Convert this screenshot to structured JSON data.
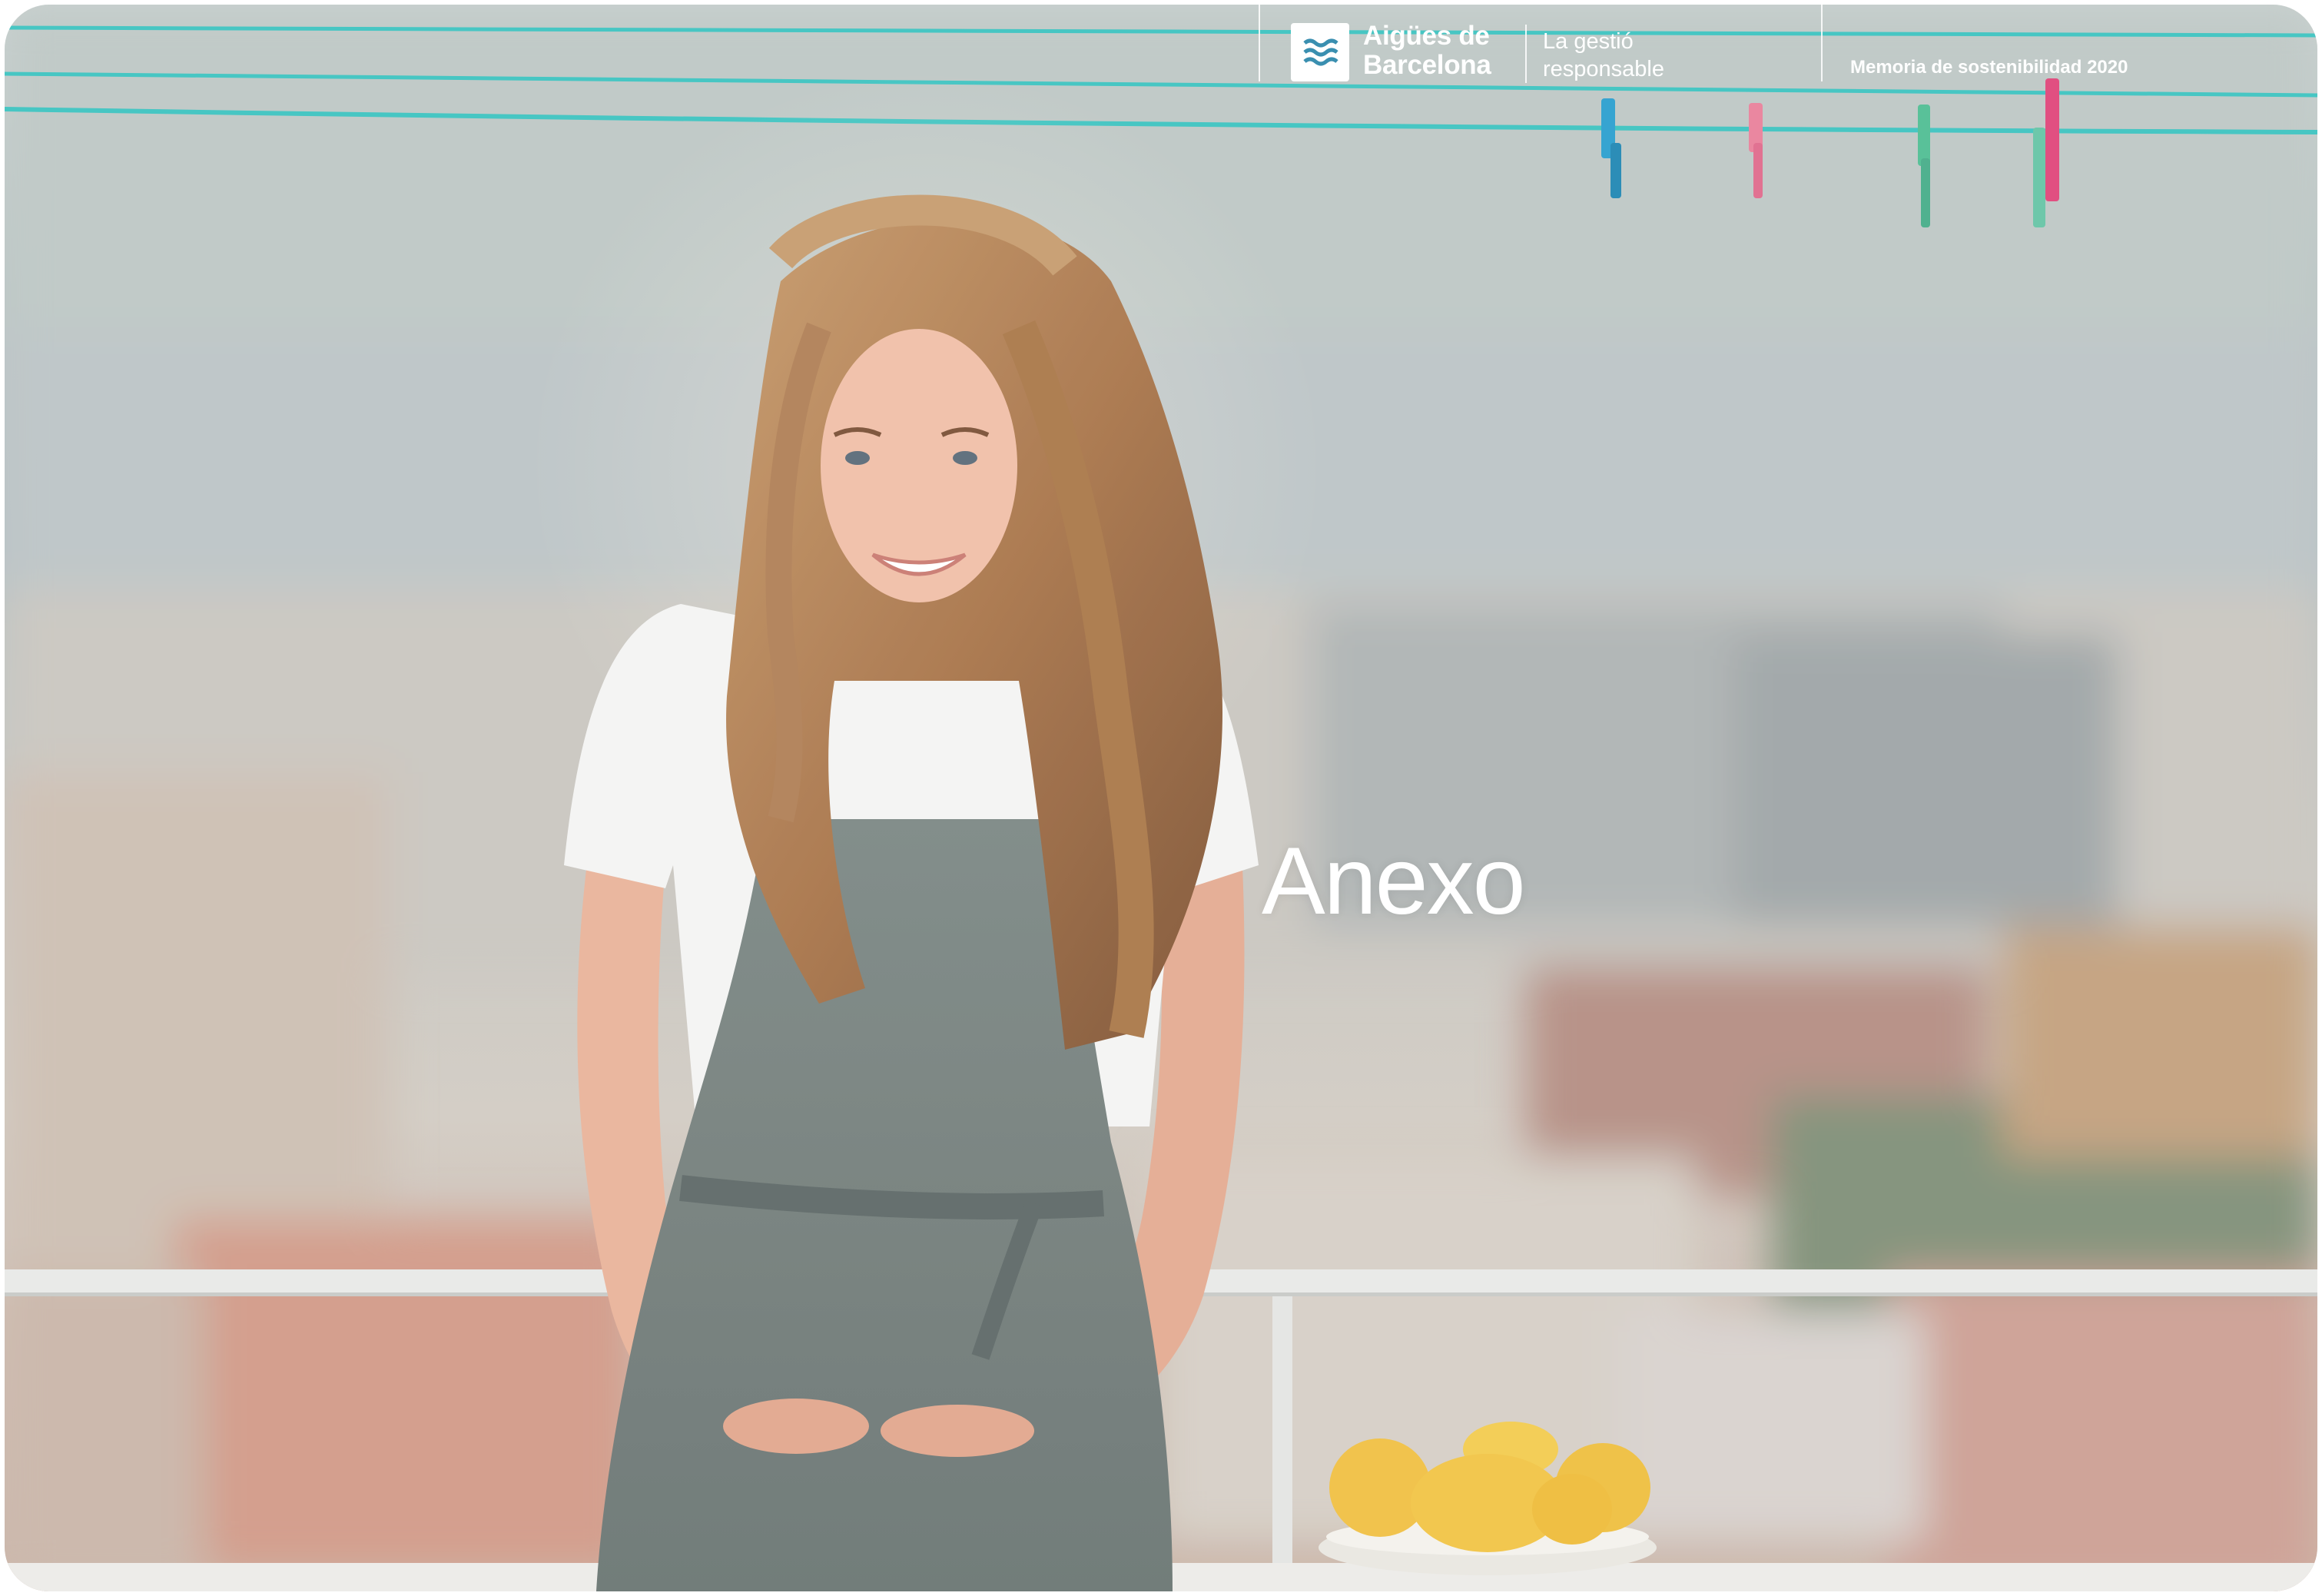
{
  "header": {
    "logo_icon": "aigues-wave-icon",
    "brand_line1": "Aigües de",
    "brand_line2": "Barcelona",
    "tagline_line1": "La gestió",
    "tagline_line2": "responsable",
    "report_title": "Memoria de sostenibilidad 2020"
  },
  "main": {
    "title": "Anexo"
  },
  "colors": {
    "accent_teal": "#3cc3c0",
    "text_white": "#ffffff"
  }
}
